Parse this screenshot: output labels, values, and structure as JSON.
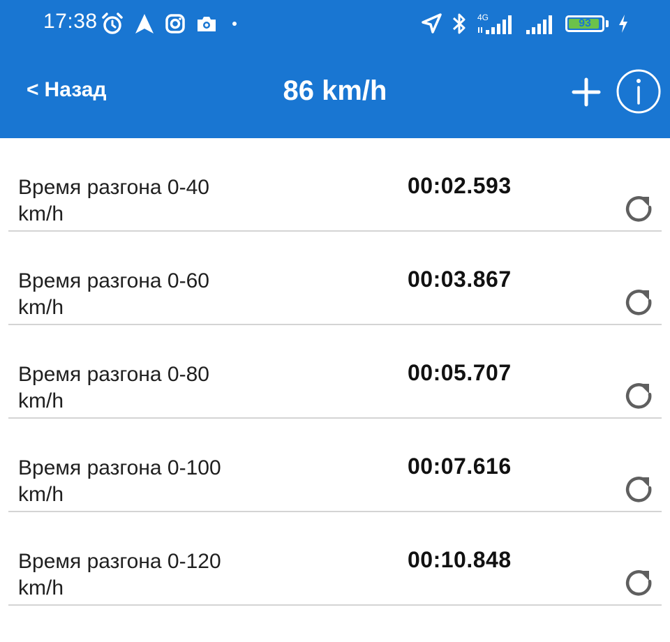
{
  "status_bar": {
    "time": "17:38",
    "left_icons": [
      "alarm-icon",
      "navigation-icon",
      "instagram-icon",
      "camera-icon",
      "dot-icon"
    ],
    "right_icons": [
      "location-arrow-icon",
      "bluetooth-icon",
      "signal-4g-icon",
      "signal-icon",
      "battery-icon",
      "charging-icon"
    ],
    "network_type": "4G",
    "battery_level": 93,
    "battery_text": "93"
  },
  "app_bar": {
    "back_label": "Назад",
    "back_chevron": "<",
    "title": "86 km/h",
    "add_icon": "plus-icon",
    "info_icon": "info-icon",
    "background_color": "#1976d2"
  },
  "results": [
    {
      "label": "Время разгона  0-40\nkm/h",
      "time": "00:02.593"
    },
    {
      "label": "Время разгона  0-60\nkm/h",
      "time": "00:03.867"
    },
    {
      "label": "Время разгона  0-80\nkm/h",
      "time": "00:05.707"
    },
    {
      "label": "Время разгона  0-100\nkm/h",
      "time": "00:07.616"
    },
    {
      "label": "Время разгона  0-120\nkm/h",
      "time": "00:10.848"
    }
  ],
  "row_action_icon": "refresh-icon"
}
